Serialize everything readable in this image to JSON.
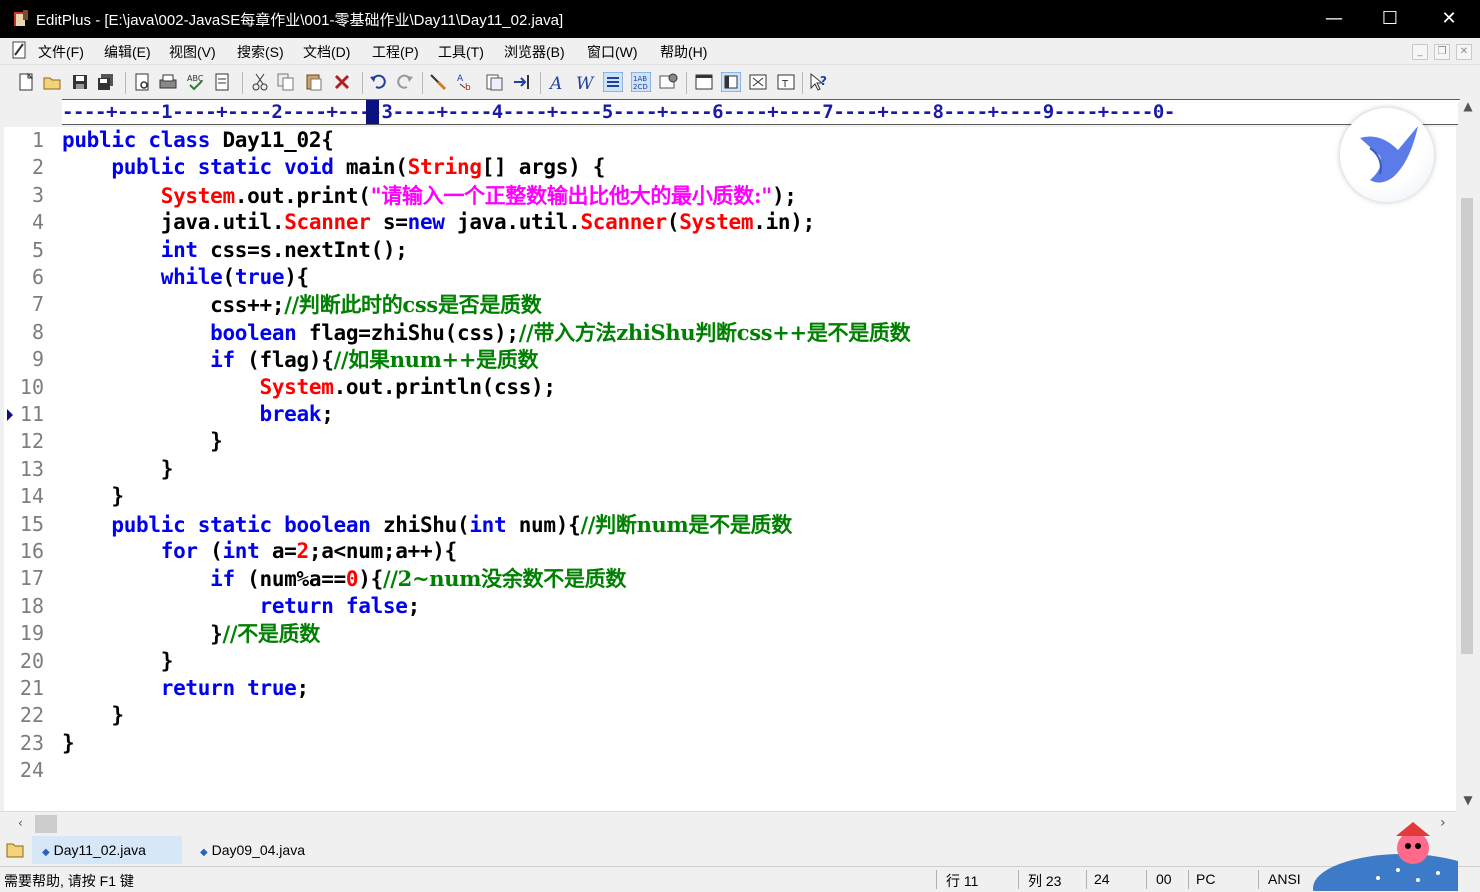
{
  "window": {
    "title": "EditPlus - [E:\\java\\002-JavaSE每章作业\\001-零基础作业\\Day11\\Day11_02.java]",
    "minimize_glyph": "—",
    "maximize_glyph": "☐",
    "close_glyph": "✕"
  },
  "menu": [
    "文件(F)",
    "编辑(E)",
    "视图(V)",
    "搜索(S)",
    "文档(D)",
    "工程(P)",
    "工具(T)",
    "浏览器(B)",
    "窗口(W)",
    "帮助(H)"
  ],
  "ruler": {
    "text": "----+----1----+----2----+----3----+----4----+----5----+----6----+----7----+----8----+----9----+----0-"
  },
  "toolbar_icons": [
    "new-file-icon",
    "open-icon",
    "save-icon",
    "save-all-icon",
    "print-preview-icon",
    "print-icon",
    "spell-check-icon",
    "document-icon",
    "cut-icon",
    "copy-icon",
    "paste-icon",
    "delete-icon",
    "undo-icon",
    "redo-icon",
    "find-icon",
    "replace-icon",
    "clipboard-icon",
    "indent-icon",
    "font-icon",
    "word-wrap-icon",
    "line-numbers-icon",
    "ruler-icon",
    "settings-icon",
    "panel-icon",
    "window-icon",
    "browser-icon",
    "full-screen-icon",
    "help-icon"
  ],
  "editor": {
    "line_numbers": [
      "1",
      "2",
      "3",
      "4",
      "5",
      "6",
      "7",
      "8",
      "9",
      "10",
      "11",
      "12",
      "13",
      "14",
      "15",
      "16",
      "17",
      "18",
      "19",
      "20",
      "21",
      "22",
      "23",
      "24"
    ],
    "current_line": 11,
    "lines": [
      [
        {
          "t": "public class ",
          "c": "kw"
        },
        {
          "t": "Day11_02{",
          "c": ""
        }
      ],
      [
        {
          "t": "    ",
          "c": ""
        },
        {
          "t": "public static void ",
          "c": "kw"
        },
        {
          "t": "main(",
          "c": ""
        },
        {
          "t": "String",
          "c": "cls"
        },
        {
          "t": "[] args) {",
          "c": ""
        }
      ],
      [
        {
          "t": "        ",
          "c": ""
        },
        {
          "t": "System",
          "c": "cls"
        },
        {
          "t": ".out.print(",
          "c": ""
        },
        {
          "t": "\"请输入一个正整数输出比他大的最小质数:\"",
          "c": "str"
        },
        {
          "t": ");",
          "c": ""
        }
      ],
      [
        {
          "t": "        java.util.",
          "c": ""
        },
        {
          "t": "Scanner",
          "c": "cls"
        },
        {
          "t": " s=",
          "c": ""
        },
        {
          "t": "new",
          "c": "kw"
        },
        {
          "t": " java.util.",
          "c": ""
        },
        {
          "t": "Scanner",
          "c": "cls"
        },
        {
          "t": "(",
          "c": ""
        },
        {
          "t": "System",
          "c": "cls"
        },
        {
          "t": ".in);",
          "c": ""
        }
      ],
      [
        {
          "t": "        ",
          "c": ""
        },
        {
          "t": "int",
          "c": "kw"
        },
        {
          "t": " css=s.nextInt();",
          "c": ""
        }
      ],
      [
        {
          "t": "        ",
          "c": ""
        },
        {
          "t": "while",
          "c": "kw"
        },
        {
          "t": "(",
          "c": ""
        },
        {
          "t": "true",
          "c": "kw"
        },
        {
          "t": "){",
          "c": ""
        }
      ],
      [
        {
          "t": "            css++;",
          "c": ""
        },
        {
          "t": "//判断此时的css是否是质数",
          "c": "cmt"
        }
      ],
      [
        {
          "t": "            ",
          "c": ""
        },
        {
          "t": "boolean",
          "c": "kw"
        },
        {
          "t": " flag=zhiShu(css);",
          "c": ""
        },
        {
          "t": "//带入方法zhiShu判断css++是不是质数",
          "c": "cmt"
        }
      ],
      [
        {
          "t": "            ",
          "c": ""
        },
        {
          "t": "if",
          "c": "kw"
        },
        {
          "t": " (flag){",
          "c": ""
        },
        {
          "t": "//如果num++是质数",
          "c": "cmt"
        }
      ],
      [
        {
          "t": "                ",
          "c": ""
        },
        {
          "t": "System",
          "c": "cls"
        },
        {
          "t": ".out.println(css);",
          "c": ""
        }
      ],
      [
        {
          "t": "                ",
          "c": ""
        },
        {
          "t": "break",
          "c": "kw"
        },
        {
          "t": ";",
          "c": ""
        }
      ],
      [
        {
          "t": "            }",
          "c": ""
        }
      ],
      [
        {
          "t": "        }",
          "c": ""
        }
      ],
      [
        {
          "t": "    }",
          "c": ""
        }
      ],
      [
        {
          "t": "    ",
          "c": ""
        },
        {
          "t": "public static boolean ",
          "c": "kw"
        },
        {
          "t": "zhiShu(",
          "c": ""
        },
        {
          "t": "int",
          "c": "kw"
        },
        {
          "t": " num){",
          "c": ""
        },
        {
          "t": "//判断num是不是质数",
          "c": "cmt"
        }
      ],
      [
        {
          "t": "        ",
          "c": ""
        },
        {
          "t": "for",
          "c": "kw"
        },
        {
          "t": " (",
          "c": ""
        },
        {
          "t": "int",
          "c": "kw"
        },
        {
          "t": " a=",
          "c": ""
        },
        {
          "t": "2",
          "c": "num"
        },
        {
          "t": ";a<num;a++){",
          "c": ""
        }
      ],
      [
        {
          "t": "            ",
          "c": ""
        },
        {
          "t": "if",
          "c": "kw"
        },
        {
          "t": " (num%a==",
          "c": ""
        },
        {
          "t": "0",
          "c": "num"
        },
        {
          "t": "){",
          "c": ""
        },
        {
          "t": "//2~num没余数不是质数",
          "c": "cmt"
        }
      ],
      [
        {
          "t": "                ",
          "c": ""
        },
        {
          "t": "return false",
          "c": "kw"
        },
        {
          "t": ";",
          "c": ""
        }
      ],
      [
        {
          "t": "            }",
          "c": ""
        },
        {
          "t": "//不是质数",
          "c": "cmt"
        }
      ],
      [
        {
          "t": "        }",
          "c": ""
        }
      ],
      [
        {
          "t": "        ",
          "c": ""
        },
        {
          "t": "return true",
          "c": "kw"
        },
        {
          "t": ";",
          "c": ""
        }
      ],
      [
        {
          "t": "    }",
          "c": ""
        }
      ],
      [
        {
          "t": "}",
          "c": ""
        }
      ],
      [
        {
          "t": "",
          "c": ""
        }
      ]
    ]
  },
  "tabs": [
    {
      "label": "Day11_02.java",
      "active": true
    },
    {
      "label": "Day09_04.java",
      "active": false
    }
  ],
  "status": {
    "help": "需要帮助, 请按 F1 键",
    "row": "行 11",
    "col": "列 23",
    "num": "24",
    "zero": "00",
    "pc": "PC",
    "enc": "ANSI"
  },
  "colors": {
    "keyword": "#0000ee",
    "class": "#ff0000",
    "string": "#ff00ff",
    "comment": "#008000",
    "ruler": "#1a1aa8"
  }
}
